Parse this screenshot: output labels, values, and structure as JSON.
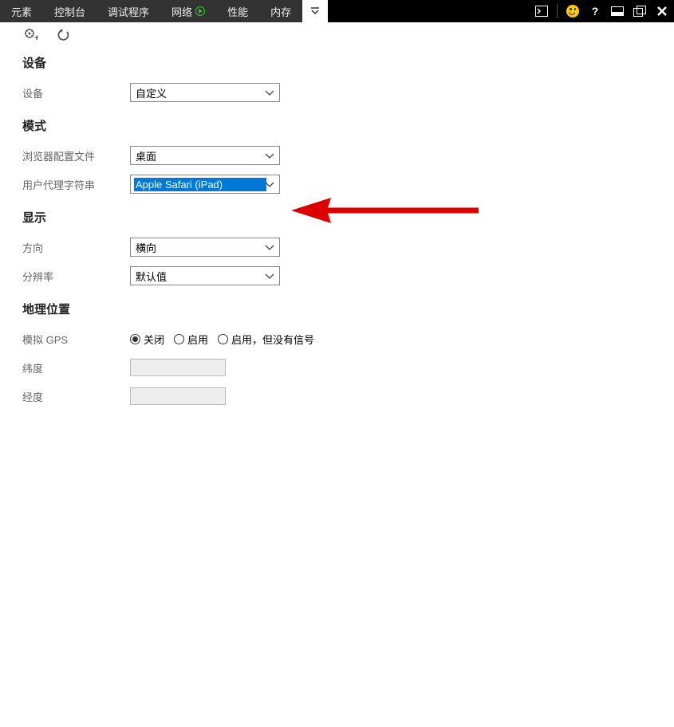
{
  "tabs": {
    "elements": "元素",
    "console": "控制台",
    "debugger": "调试程序",
    "network": "网络",
    "performance": "性能",
    "memory": "内存"
  },
  "sections": {
    "device": {
      "title": "设备",
      "device_label": "设备",
      "device_value": "自定义"
    },
    "mode": {
      "title": "模式",
      "profile_label": "浏览器配置文件",
      "profile_value": "桌面",
      "ua_label": "用户代理字符串",
      "ua_value": "Apple Safari (iPad)"
    },
    "display": {
      "title": "显示",
      "orientation_label": "方向",
      "orientation_value": "横向",
      "resolution_label": "分辨率",
      "resolution_value": "默认值"
    },
    "geo": {
      "title": "地理位置",
      "gps_label": "模拟 GPS",
      "radio_off": "关闭",
      "radio_on": "启用",
      "radio_on_nosignal": "启用，但没有信号",
      "lat_label": "纬度",
      "lng_label": "经度"
    }
  }
}
